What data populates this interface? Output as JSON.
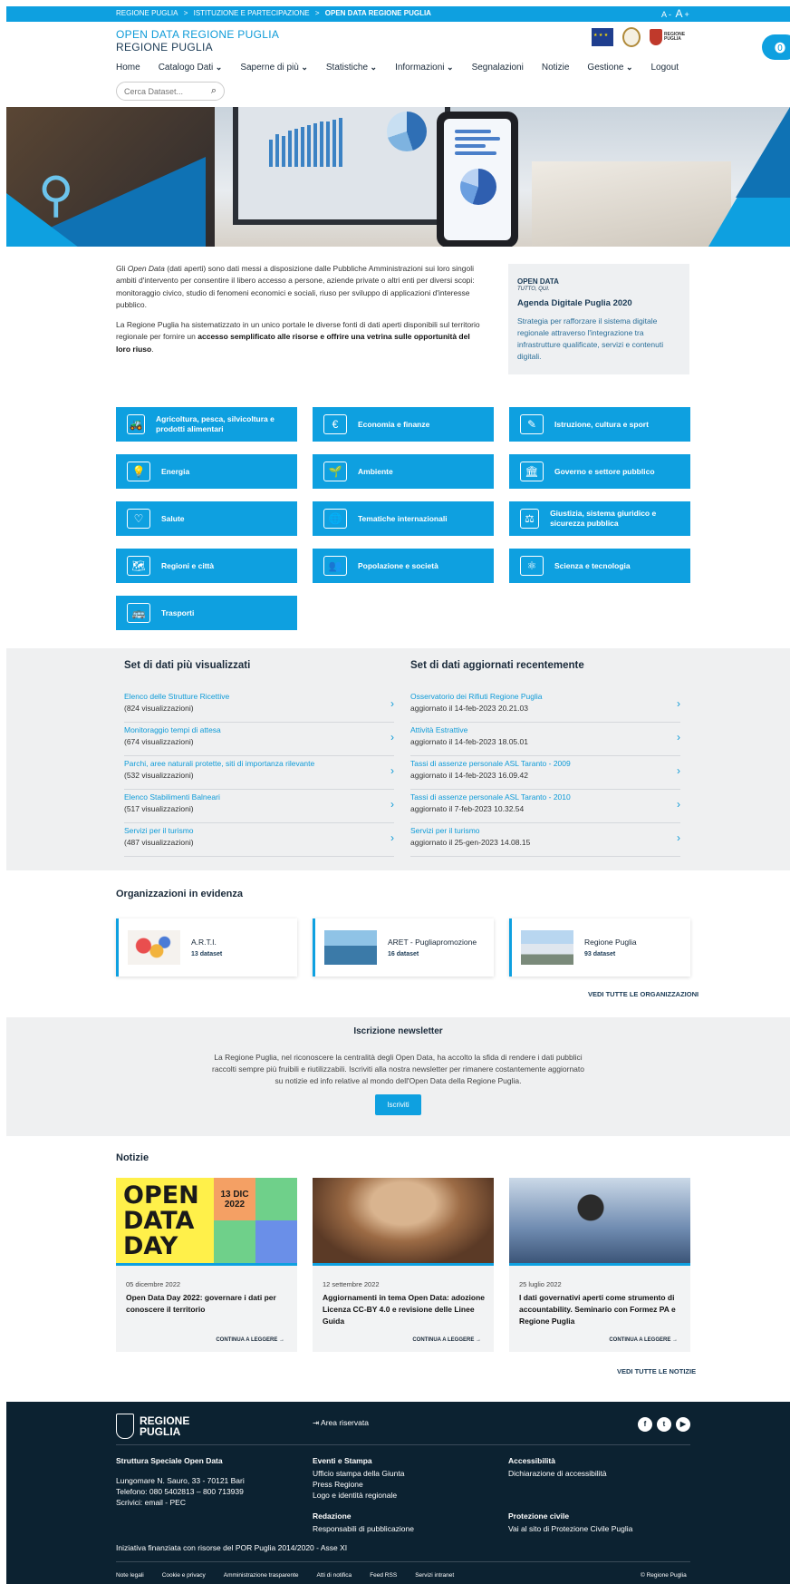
{
  "topbar": {
    "breadcrumb": [
      "REGIONE PUGLIA",
      ">",
      "ISTITUZIONE E PARTECIPAZIONE",
      ">",
      "OPEN DATA REGIONE PUGLIA"
    ],
    "font_small": "A -",
    "font_big": "A",
    "font_plus": "+"
  },
  "brand": {
    "line1": "OPEN DATA REGIONE PUGLIA",
    "line2": "REGIONE PUGLIA"
  },
  "logos": {
    "regione_label": "REGIONE PUGLIA"
  },
  "nav": {
    "items": [
      "Home",
      "Catalogo Dati",
      "Saperne di più",
      "Statistiche",
      "Informazioni",
      "Segnalazioni",
      "Notizie",
      "Gestione",
      "Logout"
    ],
    "dropdown_flags": [
      false,
      true,
      true,
      true,
      true,
      false,
      false,
      true,
      false
    ],
    "search_placeholder": "Cerca Dataset..."
  },
  "intro": {
    "p1_a": "Gli ",
    "p1_em": "Open Data",
    "p1_b": " (dati aperti) sono dati messi a disposizione dalle Pubbliche Amministrazioni sui loro singoli ambiti d'intervento per consentire il libero accesso a persone, aziende private o altri enti per diversi scopi: monitoraggio civico, studio di fenomeni economici e sociali, riuso per sviluppo di applicazioni d'interesse pubblico.",
    "p2_a": "La Regione Puglia ha sistematizzato in un unico portale le diverse fonti di dati aperti disponibili sul territorio regionale per fornire un ",
    "p2_b": "accesso semplificato alle risorse e offrire una vetrina sulle opportunità del loro riuso",
    "p2_c": "."
  },
  "agenda": {
    "logo_text": "OPEN DATA",
    "logo_sub": "TUTTO, QUI.",
    "title": "Agenda Digitale Puglia 2020",
    "text": "Strategia per rafforzare il sistema digitale regionale attraverso l'integrazione tra infrastrutture qualificate, servizi e contenuti digitali."
  },
  "categories": [
    {
      "label": "Agricoltura, pesca, silvicoltura e prodotti alimentari",
      "icon": "🚜"
    },
    {
      "label": "Economia e finanze",
      "icon": "€"
    },
    {
      "label": "Istruzione, cultura e sport",
      "icon": "✎"
    },
    {
      "label": "Energia",
      "icon": "💡"
    },
    {
      "label": "Ambiente",
      "icon": "🌱"
    },
    {
      "label": "Governo e settore pubblico",
      "icon": "🏛"
    },
    {
      "label": "Salute",
      "icon": "♡"
    },
    {
      "label": "Tematiche internazionali",
      "icon": "🌐"
    },
    {
      "label": "Giustizia, sistema giuridico e sicurezza pubblica",
      "icon": "⚖"
    },
    {
      "label": "Regioni e città",
      "icon": "🗺"
    },
    {
      "label": "Popolazione e società",
      "icon": "👥"
    },
    {
      "label": "Scienza e tecnologia",
      "icon": "⚛"
    },
    {
      "label": "Trasporti",
      "icon": "🚌"
    }
  ],
  "most_viewed": {
    "title": "Set di dati più visualizzati",
    "rows": [
      {
        "title": "Elenco delle Strutture Ricettive",
        "sub": "(824 visualizzazioni)"
      },
      {
        "title": "Monitoraggio tempi di attesa",
        "sub": "(674 visualizzazioni)"
      },
      {
        "title": "Parchi, aree naturali protette, siti di importanza rilevante",
        "sub": "(532 visualizzazioni)"
      },
      {
        "title": "Elenco Stabilimenti Balneari",
        "sub": "(517 visualizzazioni)"
      },
      {
        "title": "Servizi per il turismo",
        "sub": "(487 visualizzazioni)"
      }
    ]
  },
  "recent": {
    "title": "Set di dati aggiornati recentemente",
    "rows": [
      {
        "title": "Osservatorio dei Rifiuti Regione Puglia",
        "sub": "aggiornato il 14-feb-2023 20.21.03"
      },
      {
        "title": "Attività Estrattive",
        "sub": "aggiornato il 14-feb-2023 18.05.01"
      },
      {
        "title": "Tassi di assenze personale ASL Taranto - 2009",
        "sub": "aggiornato il 14-feb-2023 16.09.42"
      },
      {
        "title": "Tassi di assenze personale ASL Taranto - 2010",
        "sub": "aggiornato il 7-feb-2023 10.32.54"
      },
      {
        "title": "Servizi per il turismo",
        "sub": "aggiornato il 25-gen-2023 14.08.15"
      }
    ]
  },
  "organizations": {
    "title": "Organizzazioni in evidenza",
    "items": [
      {
        "name": "A.R.T.I.",
        "count": "13 dataset"
      },
      {
        "name": "ARET - Pugliapromozione",
        "count": "16 dataset"
      },
      {
        "name": "Regione Puglia",
        "count": "93 dataset"
      }
    ],
    "see_all": "VEDI TUTTE LE ORGANIZZAZIONI"
  },
  "newsletter": {
    "title": "Iscrizione newsletter",
    "text": "La Regione Puglia, nel riconoscere la centralità degli Open Data, ha accolto la sfida di rendere i dati pubblici raccolti sempre più fruibili e riutilizzabili. Iscriviti alla nostra newsletter per rimanere costantemente aggiornato su notizie ed info relative al mondo dell'Open Data della Regione Puglia.",
    "button": "Iscriviti"
  },
  "news": {
    "title": "Notizie",
    "items": [
      {
        "date": "05 dicembre 2022",
        "title": "Open Data Day 2022: governare i dati per conoscere il territorio",
        "more": "CONTINUA A LEGGERE →"
      },
      {
        "date": "12 settembre 2022",
        "title": "Aggiornamenti in tema Open Data: adozione Licenza CC-BY 4.0 e revisione delle Linee Guida",
        "more": "CONTINUA A LEGGERE →"
      },
      {
        "date": "25 luglio 2022",
        "title": "I dati governativi aperti come strumento di accountability. Seminario con Formez PA e Regione Puglia",
        "more": "CONTINUA A LEGGERE →"
      }
    ],
    "odd_words": [
      "OPEN",
      "DATA",
      "DAY"
    ],
    "odd_date": "13 DIC 2022",
    "see_all": "VEDI TUTTE LE NOTIZIE"
  },
  "footer": {
    "logo_line1": "REGIONE",
    "logo_line2": "PUGLIA",
    "reserved": "Area riservata",
    "col1": {
      "title": "Struttura Speciale Open Data",
      "lines": [
        "Lungomare N. Sauro, 33 - 70121 Bari",
        "Telefono: 080 5402813 – 800 713939",
        "Scrivici: email - PEC"
      ]
    },
    "col2": {
      "title": "Eventi e Stampa",
      "lines": [
        "Ufficio stampa della Giunta",
        "Press Regione",
        "Logo e identità regionale"
      ]
    },
    "col2b": {
      "title": "Redazione",
      "lines": [
        "Responsabili di pubblicazione"
      ]
    },
    "col3": {
      "title": "Accessibilità",
      "lines": [
        "Dichiarazione di accessibilità"
      ]
    },
    "col3b": {
      "title": "Protezione civile",
      "lines": [
        "Vai al sito di Protezione Civile Puglia"
      ]
    },
    "funding": "Iniziativa finanziata con risorse del POR Puglia 2014/2020 - Asse XI",
    "legal": [
      "Note legali",
      "Cookie e privacy",
      "Amministrazione trasparente",
      "Atti di notifica",
      "Feed RSS",
      "Servizi intranet"
    ],
    "copyright": "© Regione Puglia"
  },
  "colors": {
    "accent": "#0ea0e0",
    "dark": "#0c2231",
    "panel": "#eff0f1"
  }
}
